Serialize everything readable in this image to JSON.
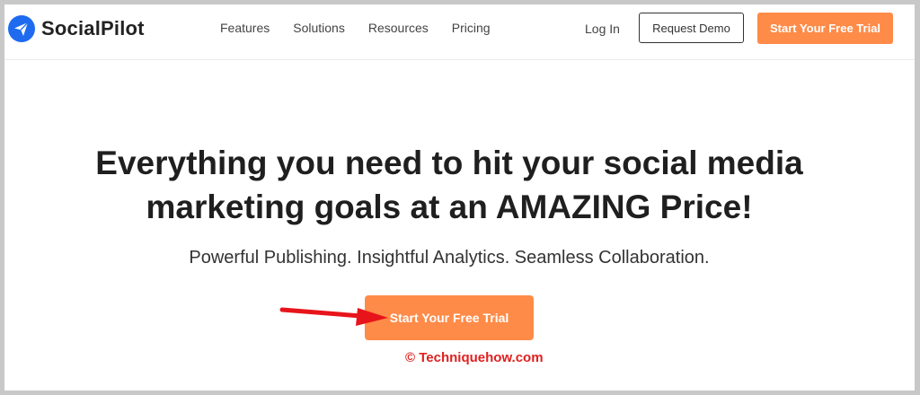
{
  "brand": {
    "name": "SocialPilot",
    "accent_color": "#ff8b48",
    "logo_color": "#1e6bf0"
  },
  "nav": {
    "items": [
      "Features",
      "Solutions",
      "Resources",
      "Pricing"
    ]
  },
  "header": {
    "login_label": "Log In",
    "demo_label": "Request Demo",
    "trial_label": "Start Your Free Trial"
  },
  "hero": {
    "title_line1": "Everything you need to hit your social media",
    "title_line2": "marketing goals at an AMAZING Price!",
    "subtitle": "Powerful Publishing. Insightful Analytics. Seamless Collaboration.",
    "cta_label": "Start Your Free Trial"
  },
  "annotation": {
    "arrow_color": "#e8141b",
    "watermark": "© Techniquehow.com"
  }
}
